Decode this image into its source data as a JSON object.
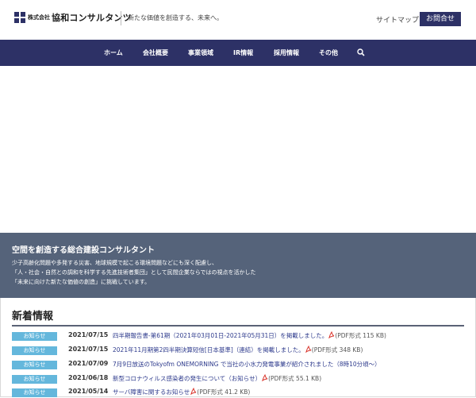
{
  "header": {
    "logo_prefix": "株式会社",
    "logo_name": "協和コンサルタンツ",
    "tagline": "新たな価値を創造する、未来へ。",
    "sitemap": "サイトマップ",
    "contact": "お問合せ"
  },
  "nav": {
    "items": [
      "ホーム",
      "会社概要",
      "事業領域",
      "IR情報",
      "採用情報",
      "その他"
    ],
    "search_icon": "search-icon"
  },
  "banner": {
    "title": "空間を創造する総合建設コンサルタント",
    "lines": [
      "少子高齢化問題や多発する災害、地球規模で起こる環境問題などにも深く配慮し、",
      "「人・社会・自然との調和を科学する先進技術者集団」として民間企業ならではの視点を活かした",
      "「未来に向けた新たな価値の創造」に挑戦しています。"
    ]
  },
  "news": {
    "heading": "新着情報",
    "items": [
      {
        "badge": "お知らせ",
        "date": "2021/07/15",
        "text": "四半期報告書-第61期（2021年03月01日-2021年05月31日）を掲載しました。",
        "pdf": true,
        "note": "(PDF形式 115 KB)"
      },
      {
        "badge": "お知らせ",
        "date": "2021/07/15",
        "text": "2021年11月期第2四半期決算短信[日本基準]（連結）を掲載しました。",
        "pdf": true,
        "note": "(PDF形式 348 KB)"
      },
      {
        "badge": "お知らせ",
        "date": "2021/07/09",
        "text": "7月9日放送のTokyofm ONEMORNING で当社の小水力発電事業が紹介されました（8時10分頃〜）",
        "pdf": false,
        "note": ""
      },
      {
        "badge": "お知らせ",
        "date": "2021/06/18",
        "text": "新型コロナウィルス感染者の発生について（お知らせ）",
        "pdf": true,
        "note": "(PDF形式 55.1 KB)"
      },
      {
        "badge": "お知らせ",
        "date": "2021/05/14",
        "text": "サーバ障害に関するお知らせ",
        "pdf": true,
        "note": "(PDF形式 41.2 KB)"
      }
    ]
  },
  "colors": {
    "brand": "#2d3166",
    "banner": "#55637a",
    "badge": "#64b7dc",
    "link": "#2d3a8c"
  }
}
